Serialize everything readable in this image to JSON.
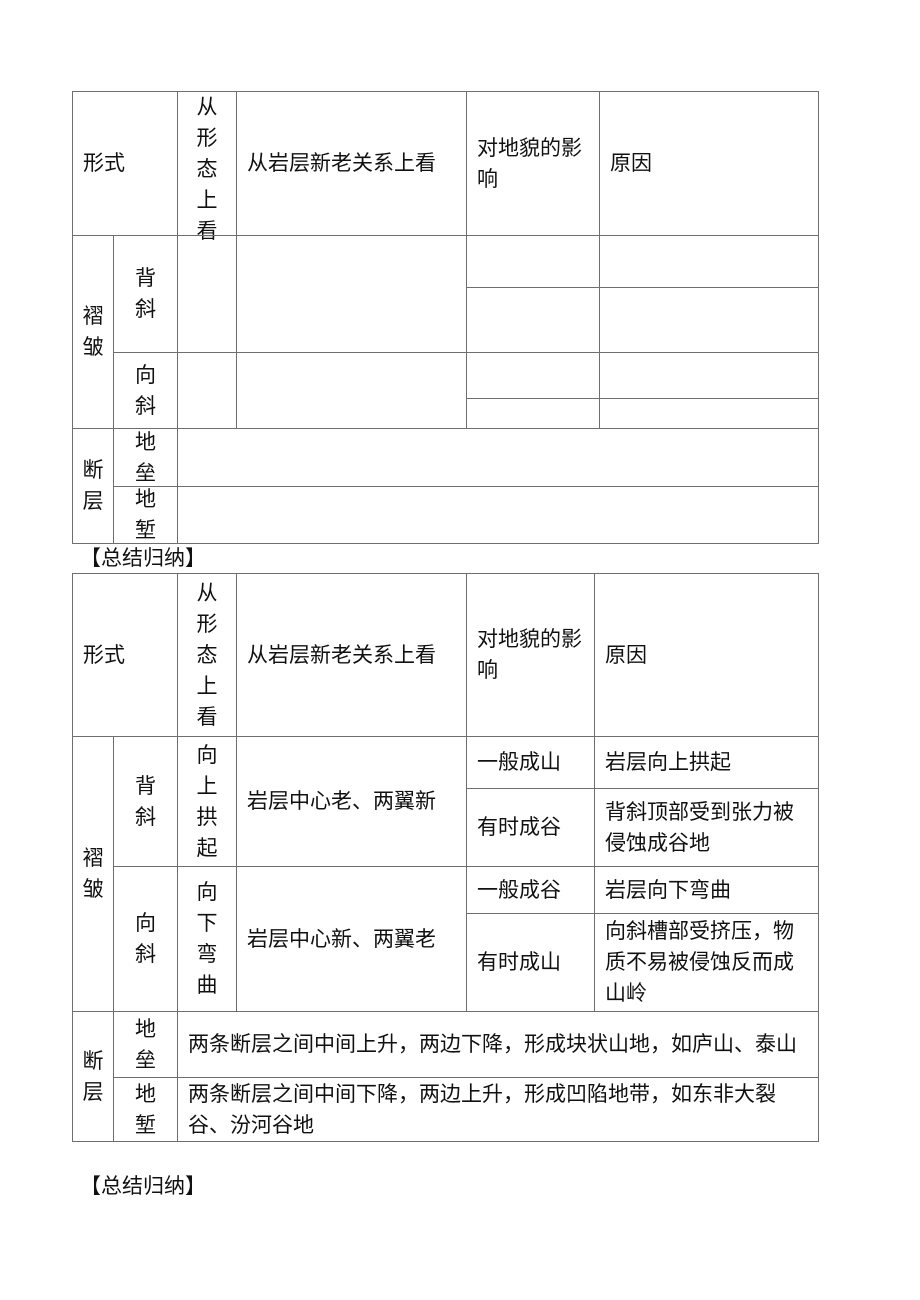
{
  "header": {
    "form": "形式",
    "morphology": "从形态上看",
    "age": "从岩层新老关系上看",
    "landform": "对地貌的影响",
    "reason": "原因"
  },
  "groups": {
    "fold": "褶皱",
    "fault": "断层"
  },
  "types": {
    "anticline": "背斜",
    "syncline": "向斜",
    "horst": "地垒",
    "graben": "地堑"
  },
  "section_heading": "【总结归纳】",
  "answers": {
    "anticline": {
      "morphology": "向上拱起",
      "age": "岩层中心老、两翼新",
      "landform_1": "一般成山",
      "reason_1": "岩层向上拱起",
      "landform_2": "有时成谷",
      "reason_2": "背斜顶部受到张力被侵蚀成谷地"
    },
    "syncline": {
      "morphology": "向下弯曲",
      "age": "岩层中心新、两翼老",
      "landform_1": "一般成谷",
      "reason_1": "岩层向下弯曲",
      "landform_2": "有时成山",
      "reason_2": "向斜槽部受挤压，物质不易被侵蚀反而成山岭"
    },
    "horst": "两条断层之间中间上升，两边下降，形成块状山地，如庐山、泰山",
    "graben": "两条断层之间中间下降，两边上升，形成凹陷地带，如东非大裂谷、汾河谷地"
  }
}
